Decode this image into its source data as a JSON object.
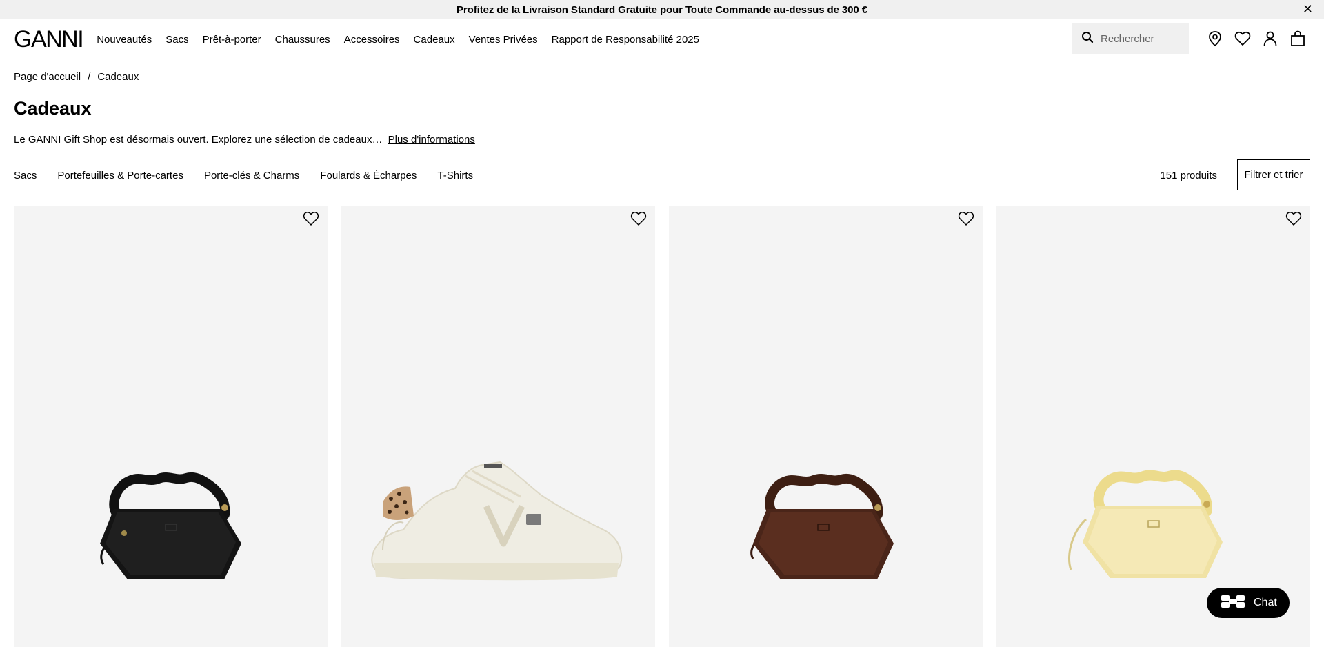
{
  "announcement": {
    "text": "Profitez de la Livraison Standard Gratuite pour Toute Commande au-dessus de 300 €",
    "close": "✕"
  },
  "header": {
    "logo": "GANNI",
    "nav": [
      "Nouveautés",
      "Sacs",
      "Prêt-à-porter",
      "Chaussures",
      "Accessoires",
      "Cadeaux",
      "Ventes Privées",
      "Rapport de Responsabilité 2025"
    ],
    "search_placeholder": "Rechercher",
    "icons": [
      "search-icon",
      "location-pin-icon",
      "heart-icon",
      "user-icon",
      "bag-icon"
    ]
  },
  "breadcrumb": {
    "items": [
      "Page d'accueil",
      "Cadeaux"
    ],
    "separator": "/"
  },
  "page": {
    "title": "Cadeaux",
    "intro": "Le GANNI Gift Shop est désormais ouvert. Explorez une sélection de cadeaux…",
    "more_link": "Plus d'informations"
  },
  "subcategories": [
    "Sacs",
    "Portefeuilles & Porte-cartes",
    "Porte-clés & Charms",
    "Foulards & Écharpes",
    "T-Shirts"
  ],
  "product_count": "151 produits",
  "filter_label": "Filtrer et trier",
  "products": [
    {
      "image": "black-ruched-handle-bag",
      "color": "#1a1a1a"
    },
    {
      "image": "cream-sneaker-leopard-heel",
      "color": "#efede2"
    },
    {
      "image": "brown-ruched-handle-bag",
      "color": "#4a2619"
    },
    {
      "image": "yellow-ruched-handle-bag",
      "color": "#f2e5a8"
    }
  ],
  "chat": {
    "label": "Chat"
  },
  "colors": {
    "announcement_bg": "#f0f0f0",
    "card_bg": "#f4f4f4",
    "chat_bg": "#000000"
  }
}
